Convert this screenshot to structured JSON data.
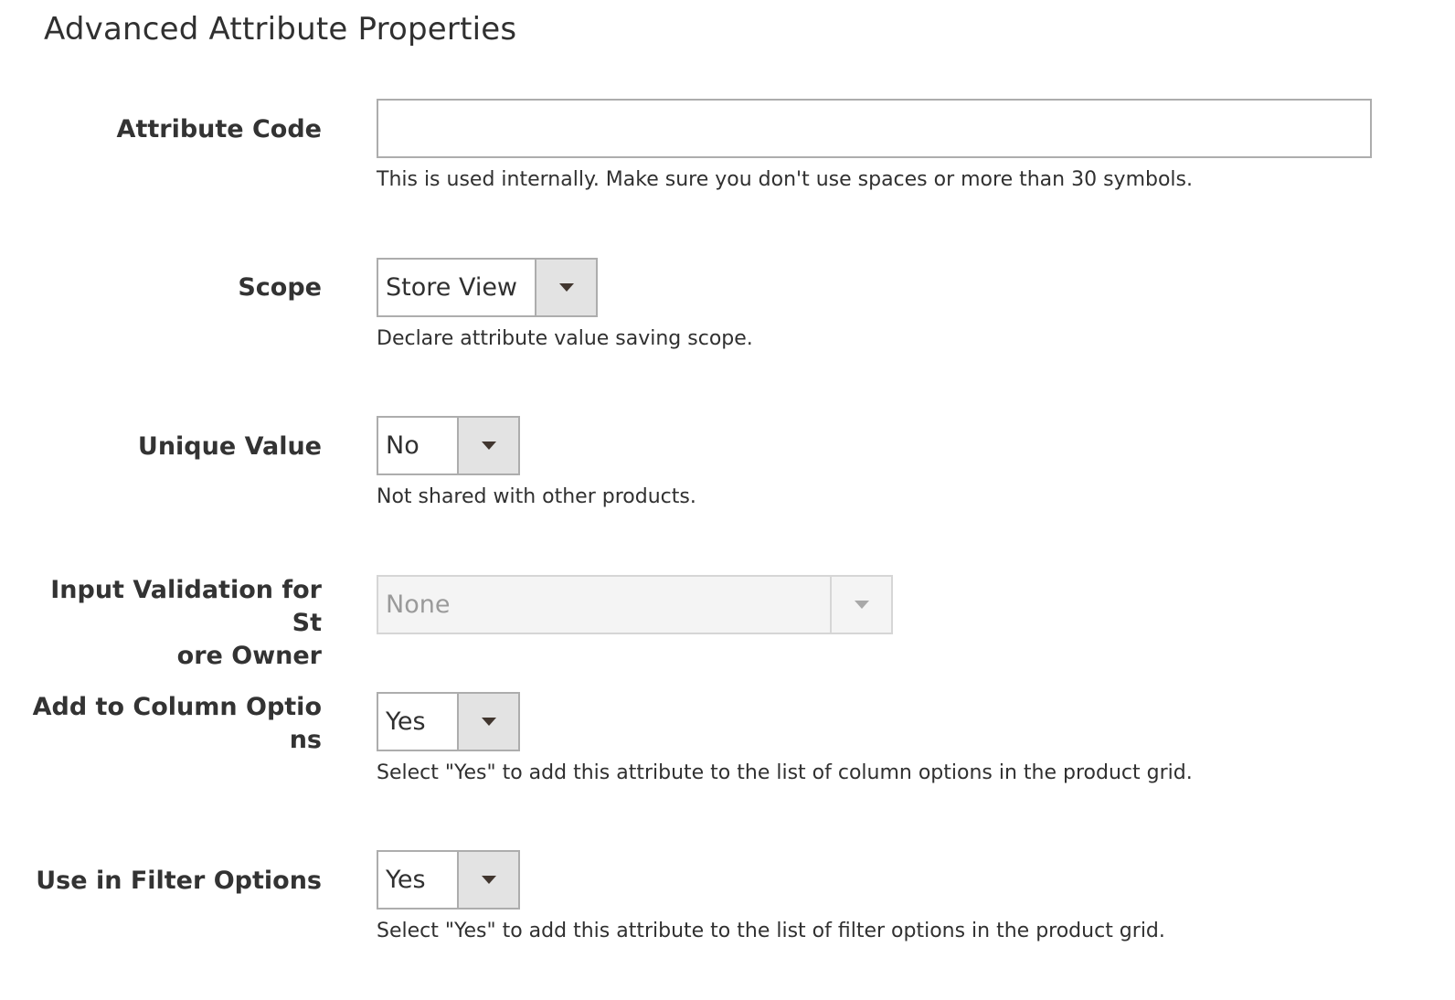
{
  "section": {
    "title": "Advanced Attribute Properties"
  },
  "fields": {
    "attribute_code": {
      "label": "Attribute Code",
      "value": "",
      "note": "This is used internally. Make sure you don't use spaces or more than 30 symbols."
    },
    "scope": {
      "label": "Scope",
      "selected": "Store View",
      "note": "Declare attribute value saving scope."
    },
    "unique_value": {
      "label": "Unique Value",
      "selected": "No",
      "note": "Not shared with other products."
    },
    "input_validation": {
      "label_line1": "Input Validation for St",
      "label_line2": "ore Owner",
      "selected": "None"
    },
    "add_to_column_options": {
      "label_line1": "Add to Column Optio",
      "label_line2": "ns",
      "selected": "Yes",
      "note": "Select \"Yes\" to add this attribute to the list of column options in the product grid."
    },
    "use_in_filter_options": {
      "label": "Use in Filter Options",
      "selected": "Yes",
      "note": "Select \"Yes\" to add this attribute to the list of filter options in the product grid."
    }
  }
}
